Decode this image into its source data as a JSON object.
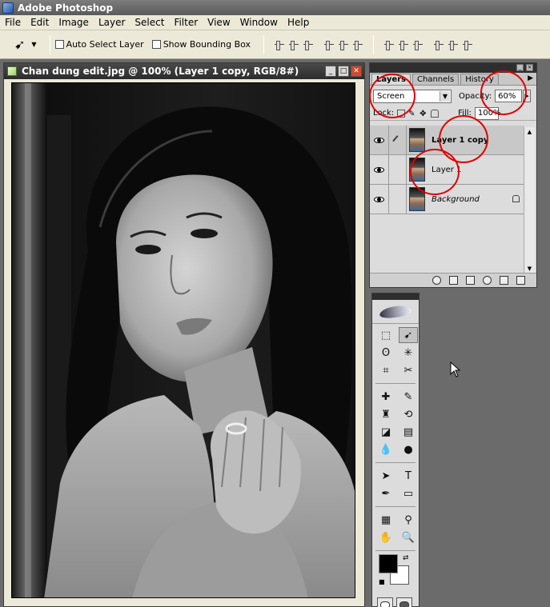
{
  "app": {
    "title": "Adobe Photoshop"
  },
  "menu": [
    "File",
    "Edit",
    "Image",
    "Layer",
    "Select",
    "Filter",
    "View",
    "Window",
    "Help"
  ],
  "options": {
    "auto_select": "Auto Select Layer",
    "bounding_box": "Show Bounding Box"
  },
  "document": {
    "title": "Chan dung edit.jpg @ 100% (Layer 1 copy, RGB/8#)"
  },
  "layers_panel": {
    "tabs": [
      "Layers",
      "Channels",
      "History"
    ],
    "blend_mode": "Screen",
    "opacity_label": "Opacity:",
    "opacity_value": "60%",
    "lock_label": "Lock:",
    "fill_label": "Fill:",
    "fill_value": "100%",
    "layers": [
      {
        "name": "Layer 1 copy",
        "selected": true
      },
      {
        "name": "Layer 1",
        "selected": false
      },
      {
        "name": "Background",
        "selected": false,
        "locked": true
      }
    ]
  },
  "colors": {
    "annotation_red": "#e00000",
    "foreground": "#000000",
    "background": "#ffffff"
  },
  "icons": {
    "move": "move-tool-icon",
    "eye": "eye-icon",
    "brush": "brush-icon",
    "lock": "lock-icon"
  }
}
